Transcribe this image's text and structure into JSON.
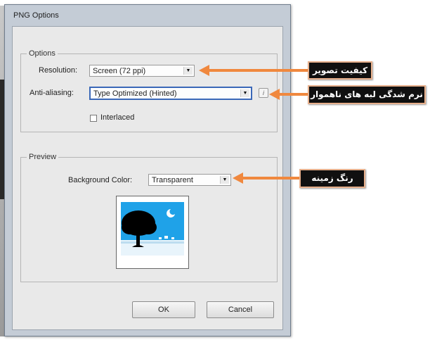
{
  "dialog": {
    "title": "PNG Options",
    "options_group": {
      "legend": "Options",
      "resolution": {
        "label": "Resolution:",
        "value": "Screen (72 ppi)"
      },
      "anti_aliasing": {
        "label": "Anti-aliasing:",
        "value": "Type Optimized (Hinted)"
      },
      "info_icon": "i",
      "interlaced": {
        "label": "Interlaced",
        "checked": false
      }
    },
    "preview_group": {
      "legend": "Preview",
      "background_color": {
        "label": "Background Color:",
        "value": "Transparent"
      }
    },
    "buttons": {
      "ok": "OK",
      "cancel": "Cancel"
    }
  },
  "annotations": {
    "resolution": "کیفیت تصویر",
    "anti_aliasing": "نرم شدگی لبه های ناهموار",
    "background": "رنگ زمینه"
  },
  "colors": {
    "annotation_arrow": "#f0883e",
    "annotation_bg": "#101010",
    "preview_sky": "#1fa2e8"
  }
}
